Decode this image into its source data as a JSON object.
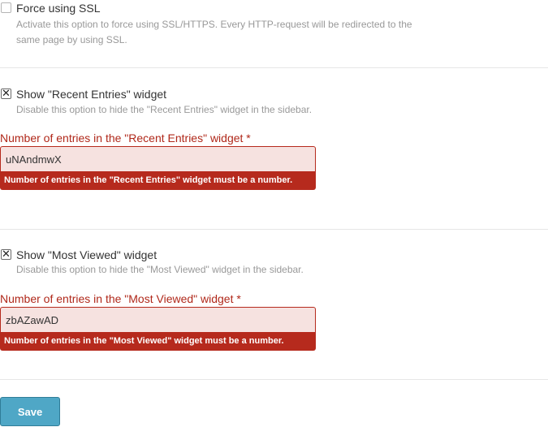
{
  "force_ssl": {
    "label": "Force using SSL",
    "help": "Activate this option to force using SSL/HTTPS. Every HTTP-request will be redirected to the same page by using SSL.",
    "checked": false
  },
  "recent_entries": {
    "label": "Show \"Recent Entries\" widget",
    "help": "Disable this option to hide the \"Recent Entries\" widget in the sidebar.",
    "checked": true,
    "check_mark": "✕",
    "field_label": "Number of entries in the \"Recent Entries\" widget *",
    "field_value": "uNAndmwX",
    "error": "Number of entries in the \"Recent Entries\" widget must be a number."
  },
  "most_viewed": {
    "label": "Show \"Most Viewed\" widget",
    "help": "Disable this option to hide the \"Most Viewed\" widget in the sidebar.",
    "checked": true,
    "check_mark": "✕",
    "field_label": "Number of entries in the \"Most Viewed\" widget *",
    "field_value": "zbAZawAD",
    "error": "Number of entries in the \"Most Viewed\" widget must be a number."
  },
  "actions": {
    "save_label": "Save"
  },
  "colors": {
    "error": "#b62a1d",
    "error_bg": "#f6e2e0",
    "button": "#4fa7c6"
  }
}
